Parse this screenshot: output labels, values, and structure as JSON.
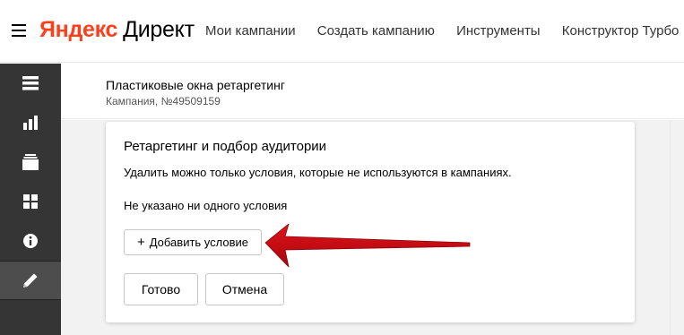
{
  "header": {
    "logo_brand": "Яндекс",
    "logo_product": "Директ",
    "nav": [
      {
        "label": "Мои кампании"
      },
      {
        "label": "Создать кампанию"
      },
      {
        "label": "Инструменты"
      },
      {
        "label": "Конструктор Турбо"
      }
    ]
  },
  "sidebar": {
    "items": [
      {
        "icon": "list-icon",
        "active": false
      },
      {
        "icon": "bar-chart-icon",
        "active": false
      },
      {
        "icon": "stack-icon",
        "active": false
      },
      {
        "icon": "grid-icon",
        "active": false
      },
      {
        "icon": "info-icon",
        "active": false
      },
      {
        "icon": "pencil-icon",
        "active": true
      }
    ]
  },
  "campaign": {
    "title": "Пластиковые окна ретаргетинг",
    "subtitle": "Кампания, №49509159"
  },
  "dialog": {
    "title": "Ретаргетинг и подбор аудитории",
    "note": "Удалить можно только условия, которые не используются в кампаниях.",
    "empty_text": "Не указано ни одного условия",
    "add_button": "Добавить условие",
    "add_button_icon": "+",
    "done_button": "Готово",
    "cancel_button": "Отмена"
  },
  "colors": {
    "logo_accent": "#fc3f1d",
    "sidebar_bg": "#353535",
    "sidebar_active_bg": "#4d4d4d",
    "workspace_bg": "#f2f2f2",
    "annotation_arrow": "#c4070f"
  }
}
